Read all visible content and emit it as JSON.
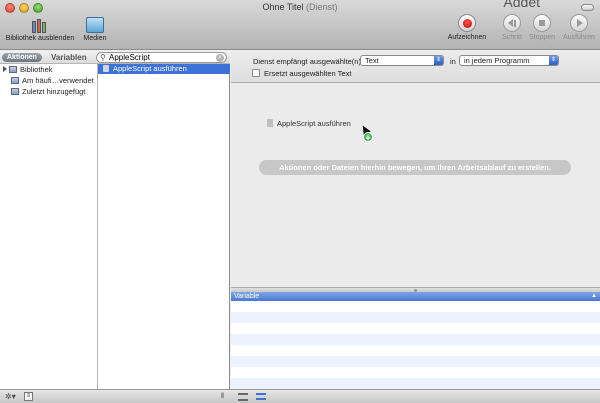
{
  "window": {
    "title": "Ohne Titel",
    "subtitle": "(Dienst)",
    "top_right_text": "Addet"
  },
  "toolbar": {
    "hide_library_label": "Bibliothek ausblenden",
    "media_label": "Medien",
    "record_label": "Aufzeichnen",
    "step_label": "Schritt",
    "stop_label": "Stoppen",
    "run_label": "Ausführen"
  },
  "library": {
    "tab_actions": "Aktionen",
    "tab_variables": "Variablen",
    "search": {
      "value": "AppleScript",
      "placeholder": ""
    },
    "tree": [
      {
        "label": "Bibliothek"
      },
      {
        "label": "Am häufi…verwendet"
      },
      {
        "label": "Zuletzt hinzugefügt"
      }
    ],
    "results": [
      {
        "label": "AppleScript ausführen"
      }
    ]
  },
  "service": {
    "receives_label": "Dienst empfängt ausgewählte(n)",
    "input_type": "Text",
    "in_label": "in",
    "application": "in jedem Programm",
    "replace_label": "Ersetzt ausgewählten Text",
    "replace_checked": false
  },
  "workflow": {
    "dragged_action": "AppleScript ausführen",
    "drop_hint": "Aktionen oder Dateien hierhin bewegen, um Ihren Arbeitsablauf zu erstellen."
  },
  "variables": {
    "column_header": "Variable",
    "rows": 8
  },
  "colors": {
    "selection": "#3d73d6",
    "record": "#cc0000",
    "add_badge": "#1f8a30"
  }
}
